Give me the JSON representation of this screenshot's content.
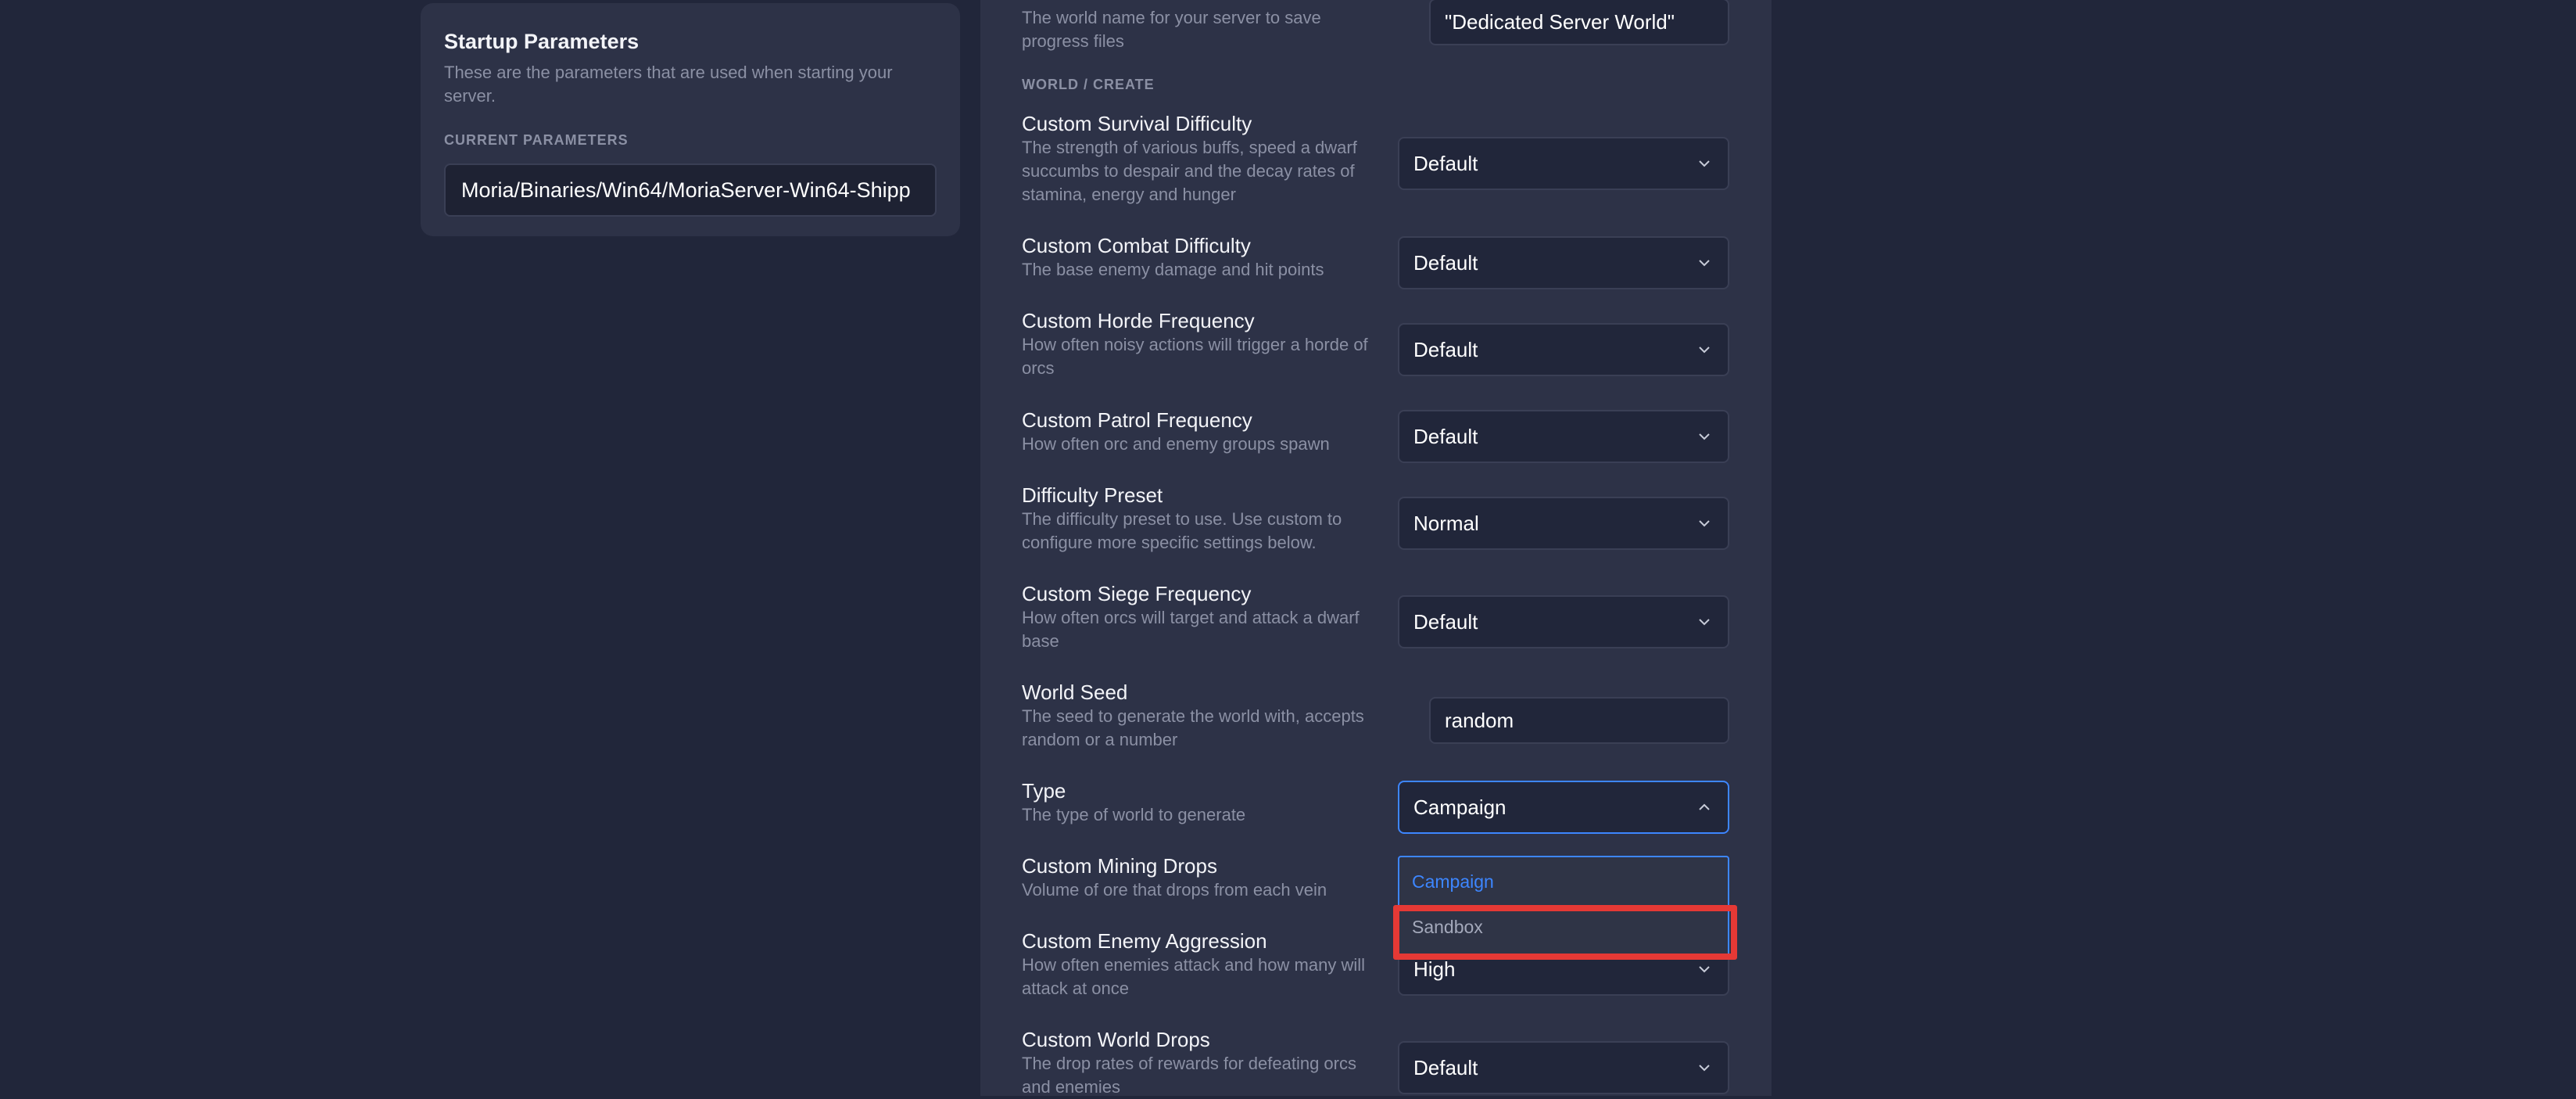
{
  "startup": {
    "title": "Startup Parameters",
    "description": "These are the parameters that are used when starting your server.",
    "current_label": "CURRENT PARAMETERS",
    "current_value": "Moria/Binaries/Win64/MoriaServer-Win64-Shipp"
  },
  "top_setting": {
    "description": "The world name for your server to save progress files",
    "value": "\"Dedicated Server World\""
  },
  "section_label": "WORLD / CREATE",
  "settings": [
    {
      "label": "Custom Survival Difficulty",
      "description": "The strength of various buffs, speed a dwarf succumbs to despair and the decay rates of stamina, energy and hunger",
      "value": "Default"
    },
    {
      "label": "Custom Combat Difficulty",
      "description": "The base enemy damage and hit points",
      "value": "Default"
    },
    {
      "label": "Custom Horde Frequency",
      "description": "How often noisy actions will trigger a horde of orcs",
      "value": "Default"
    },
    {
      "label": "Custom Patrol Frequency",
      "description": "How often orc and enemy groups spawn",
      "value": "Default"
    },
    {
      "label": "Difficulty Preset",
      "description": "The difficulty preset to use. Use custom to configure more specific settings below.",
      "value": "Normal"
    },
    {
      "label": "Custom Siege Frequency",
      "description": "How often orcs will target and attack a dwarf base",
      "value": "Default"
    },
    {
      "label": "World Seed",
      "description": "The seed to generate the world with, accepts random or a number",
      "value": "random"
    },
    {
      "label": "Type",
      "description": "The type of world to generate",
      "value": "Campaign"
    },
    {
      "label": "Custom Mining Drops",
      "description": "Volume of ore that drops from each vein",
      "value": ""
    },
    {
      "label": "Custom Enemy Aggression",
      "description": "How often enemies attack and how many will attack at once",
      "value": "High"
    },
    {
      "label": "Custom World Drops",
      "description": "The drop rates of rewards for defeating orcs and enemies",
      "value": "Default"
    }
  ],
  "type_dropdown": {
    "options": [
      "Campaign",
      "Sandbox"
    ],
    "selected": "Campaign"
  },
  "colors": {
    "accent": "#3d86ff",
    "highlight": "#e53935",
    "page_bg": "#21263a",
    "panel_bg": "#2d3247"
  }
}
